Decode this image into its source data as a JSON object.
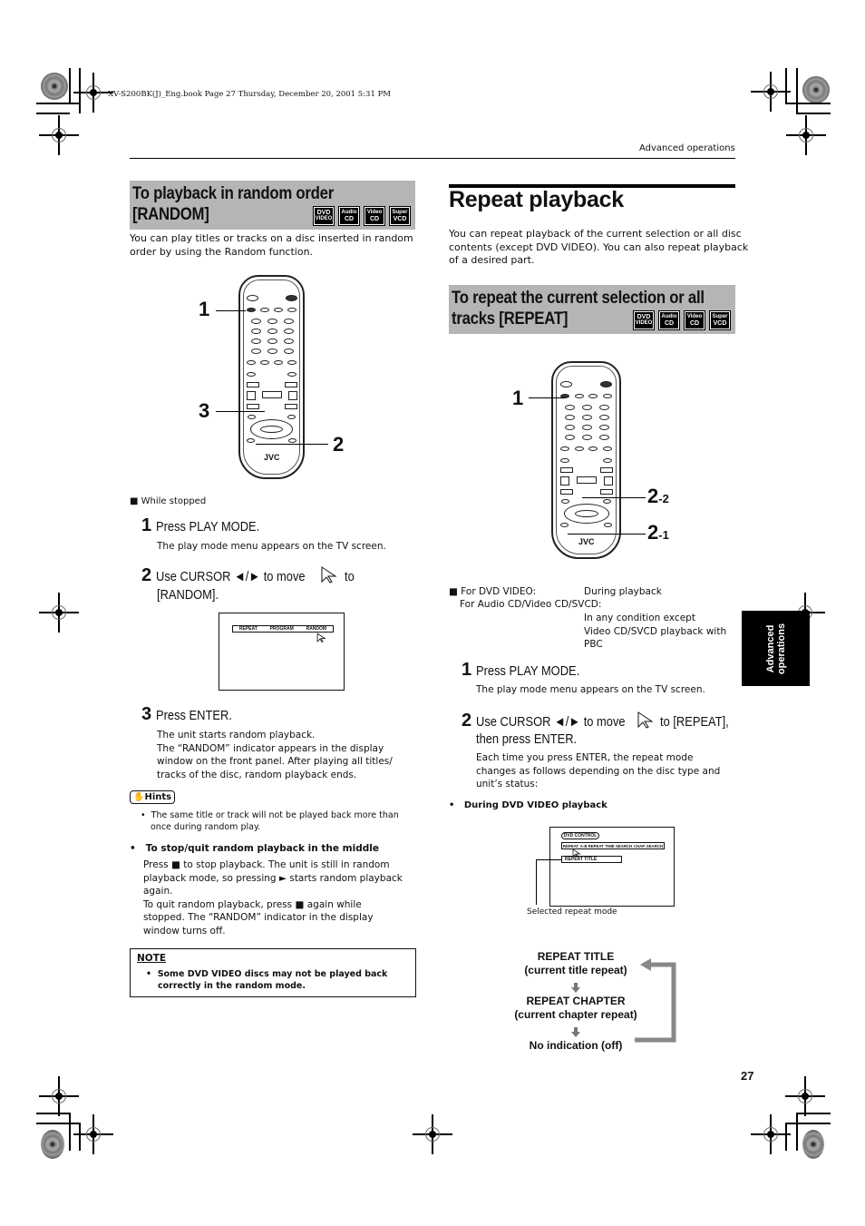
{
  "file_info": "XV-S200BK(J)_Eng.book  Page 27  Thursday, December 20, 2001  5:31 PM",
  "running_head": "Advanced operations",
  "page_number": "27",
  "side_tab": {
    "line1": "Advanced",
    "line2": "operations"
  },
  "disc_badges": [
    {
      "icon": "dvd-video-badge",
      "top": "DVD",
      "bottom": "VIDEO"
    },
    {
      "icon": "audio-cd-badge",
      "top": "Audio",
      "bottom": "CD"
    },
    {
      "icon": "video-cd-badge",
      "top": "Video",
      "bottom": "CD"
    },
    {
      "icon": "super-vcd-badge",
      "top": "Super",
      "bottom": "VCD"
    }
  ],
  "left": {
    "heading_line1": "To playback  in random order",
    "heading_line2": "[RANDOM]",
    "intro_line1": "You can play titles or tracks on a disc inserted in random",
    "intro_line2": "order by using the Random function.",
    "callouts": [
      "1",
      "3",
      "2"
    ],
    "remote_brand": "JVC",
    "condition": "■ While stopped",
    "steps": [
      {
        "num": "1",
        "title": "Press PLAY MODE.",
        "desc": "The play mode menu appears on the TV screen."
      },
      {
        "num": "2",
        "title_a": "Use CURSOR ◄/► to move",
        "title_b": "to",
        "title_c": "[RANDOM]."
      },
      {
        "num": "3",
        "title": "Press ENTER.",
        "desc_lines": [
          "The unit starts random playback.",
          "The “RANDOM” indicator appears in the display",
          "window on the front panel. After playing all titles/",
          "tracks of the disc, random playback ends."
        ]
      }
    ],
    "osd_menu": [
      "REPEAT",
      "PROGRAM",
      "RANDOM"
    ],
    "hints_label": "Hints",
    "hints": [
      "The same title or track will not be played back more than",
      "once during random play."
    ],
    "stop_heading": "To stop/quit random playback in the middle",
    "stop_lines": [
      "Press ■ to stop playback. The unit is still in random",
      "playback mode, so pressing ► starts random playback",
      "again.",
      "To quit random playback, press ■ again while",
      "stopped.  The “RANDOM” indicator in the display",
      "window turns off."
    ],
    "note_label": "NOTE",
    "note_lines": [
      "Some DVD VIDEO discs may not be played back",
      "correctly in the random mode."
    ]
  },
  "right": {
    "title": "Repeat playback",
    "intro_lines": [
      "You can repeat playback of the current selection or all disc",
      "contents (except DVD VIDEO). You can also repeat playback",
      "of a desired part."
    ],
    "heading_line1": "To repeat the current selection or all",
    "heading_line2": "tracks [REPEAT]",
    "callouts": [
      {
        "main": "1",
        "sub": ""
      },
      {
        "main": "2",
        "sub": "-2"
      },
      {
        "main": "2",
        "sub": "-1"
      }
    ],
    "remote_brand": "JVC",
    "condition_dvd_label": "■ For DVD VIDEO:",
    "condition_dvd_value": "During playback",
    "condition_cd_label": "For Audio CD/Video CD/SVCD:",
    "condition_cd_lines": [
      "In any condition except",
      "Video CD/SVCD playback with",
      "PBC"
    ],
    "steps": [
      {
        "num": "1",
        "title": "Press PLAY MODE.",
        "desc": "The play mode menu appears on the TV screen."
      },
      {
        "num": "2",
        "title_a": "Use CURSOR ◄/► to move",
        "title_b": "to [REPEAT],",
        "title_c": "then press ENTER.",
        "desc_lines": [
          "Each time you press ENTER, the repeat mode",
          "changes as follows depending on the disc type and",
          "unit’s status:"
        ]
      }
    ],
    "dvd_playback_label": "During DVD VIDEO playback",
    "osd": {
      "header": "DVD CONTROL",
      "menu": [
        "REPEAT",
        "A-B REPEAT",
        "TIME SEARCH",
        "CHAP. SEARCH"
      ],
      "selected": "REPEAT   TITLE"
    },
    "selected_caption": "Selected repeat mode",
    "flow": [
      {
        "line1": "REPEAT TITLE",
        "line2": "(current title repeat)"
      },
      {
        "line1": "REPEAT CHAPTER",
        "line2": "(current chapter repeat)"
      },
      {
        "line1": "No indication (off)",
        "line2": ""
      }
    ]
  }
}
